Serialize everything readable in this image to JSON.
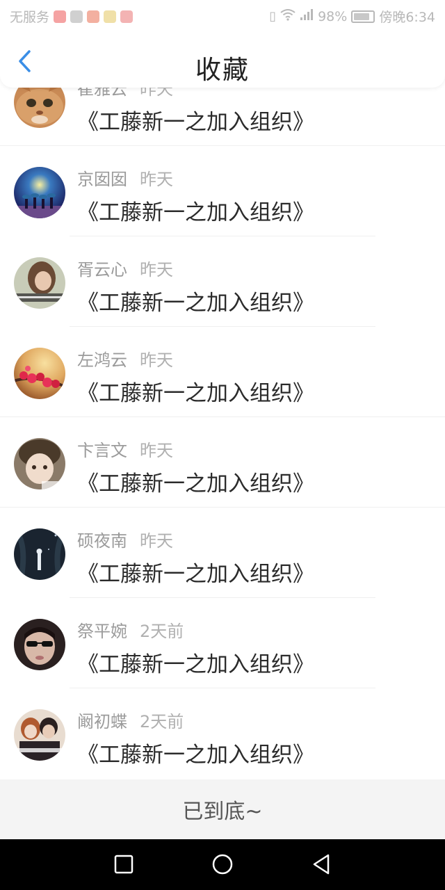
{
  "status_bar": {
    "carrier": "无服务",
    "battery_percent": "98%",
    "time": "傍晚6:34",
    "icons": [
      "vibrate-icon",
      "wifi-icon",
      "signal-icon",
      "battery-icon"
    ]
  },
  "header": {
    "title": "收藏",
    "back_icon": "chevron-left-icon",
    "accent_color": "#3a8ee6"
  },
  "items": [
    {
      "name": "崔雅云",
      "time": "昨天",
      "title": "《工藤新一之加入组织》",
      "avatar": "cat-avatar"
    },
    {
      "name": "京囡囡",
      "time": "昨天",
      "title": "《工藤新一之加入组织》",
      "avatar": "night-sky-avatar"
    },
    {
      "name": "胥云心",
      "time": "昨天",
      "title": "《工藤新一之加入组织》",
      "avatar": "girl-avatar"
    },
    {
      "name": "左鸿云",
      "time": "昨天",
      "title": "《工藤新一之加入组织》",
      "avatar": "flowers-avatar"
    },
    {
      "name": "卞言文",
      "time": "昨天",
      "title": "《工藤新一之加入组织》",
      "avatar": "cute-avatar"
    },
    {
      "name": "硕夜南",
      "time": "昨天",
      "title": "《工藤新一之加入组织》",
      "avatar": "dark-forest-avatar"
    },
    {
      "name": "祭平婉",
      "time": "2天前",
      "title": "《工藤新一之加入组织》",
      "avatar": "sunglasses-avatar"
    },
    {
      "name": "阚初蝶",
      "time": "2天前",
      "title": "《工藤新一之加入组织》",
      "avatar": "couple-avatar"
    }
  ],
  "footer": {
    "end_text": "已到底~"
  },
  "nav_bar": {
    "buttons": [
      "recent-apps-icon",
      "home-icon",
      "back-icon"
    ]
  }
}
